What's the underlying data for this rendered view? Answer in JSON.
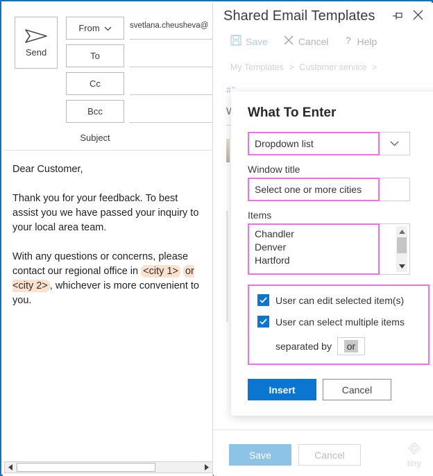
{
  "compose": {
    "send_button": {
      "label": "Send",
      "icon": "send-arrow-icon"
    },
    "address_buttons": [
      {
        "name": "from",
        "label": "From",
        "has_chevron": true
      },
      {
        "name": "to",
        "label": "To",
        "has_chevron": false
      },
      {
        "name": "cc",
        "label": "Cc",
        "has_chevron": false
      },
      {
        "name": "bcc",
        "label": "Bcc",
        "has_chevron": false
      }
    ],
    "fields": {
      "from": "svetlana.cheusheva@",
      "to": "",
      "cc": "",
      "bcc": ""
    },
    "subject_label": "Subject",
    "body": {
      "greeting": "Dear Customer,",
      "paragraph1": "Thank you for your feedback. To best assist you we have passed your inquiry to your local area team.",
      "p2_before": "With any questions or concerns, please contact our regional office in ",
      "p2_chip1": "<city 1>",
      "p2_middle": " ",
      "p2_chip2_prefix": "or ",
      "p2_chip2": "<city 2>",
      "p2_after": ", whichever is more convenient to you."
    },
    "scrollbar": {
      "left_arrow": "◀",
      "right_arrow": "▶"
    }
  },
  "templates_pane": {
    "title": "Shared Email Templates",
    "pin_icon": "pin-icon",
    "close_icon": "close-icon",
    "toolbar": [
      {
        "name": "save",
        "label": "Save",
        "icon": "floppy-disk-icon"
      },
      {
        "name": "cancel",
        "label": "Cancel",
        "icon": "x-icon"
      },
      {
        "name": "help",
        "label": "Help",
        "icon": "question-mark-icon"
      }
    ],
    "breadcrumb": {
      "root": "My Templates",
      "separator": ">",
      "folder": "Customer service",
      "trailing": ">"
    },
    "behind_modal": {
      "marker": "#\"",
      "letter": "W"
    },
    "footer": {
      "save_label": "Save",
      "cancel_label": "Cancel",
      "watermark": "tiny"
    }
  },
  "dialog": {
    "title": "What To Enter",
    "type_field": {
      "value": "Dropdown list",
      "chevron_icon": "chevron-down-icon"
    },
    "window_title_field": {
      "label": "Window title",
      "value": "Select one or more cities"
    },
    "items_field": {
      "label": "Items",
      "values": [
        "Chandler",
        "Denver",
        "Hartford"
      ],
      "scroll_up_icon": "▲",
      "scroll_down_icon": "▼"
    },
    "options": {
      "edit_selected": {
        "label": "User can edit selected item(s)",
        "checked": true
      },
      "select_multiple": {
        "label": "User can select multiple items",
        "checked": true
      },
      "separator": {
        "label": "separated by",
        "value": "or"
      }
    },
    "buttons": {
      "insert": "Insert",
      "cancel": "Cancel"
    }
  },
  "colors": {
    "window_border": "#1473b5",
    "accent_blue": "#0a76d1",
    "pink_highlight": "#f26ef0",
    "placeholder_chip": "#fce1cf",
    "disabled_save": "#8ec3e8"
  }
}
